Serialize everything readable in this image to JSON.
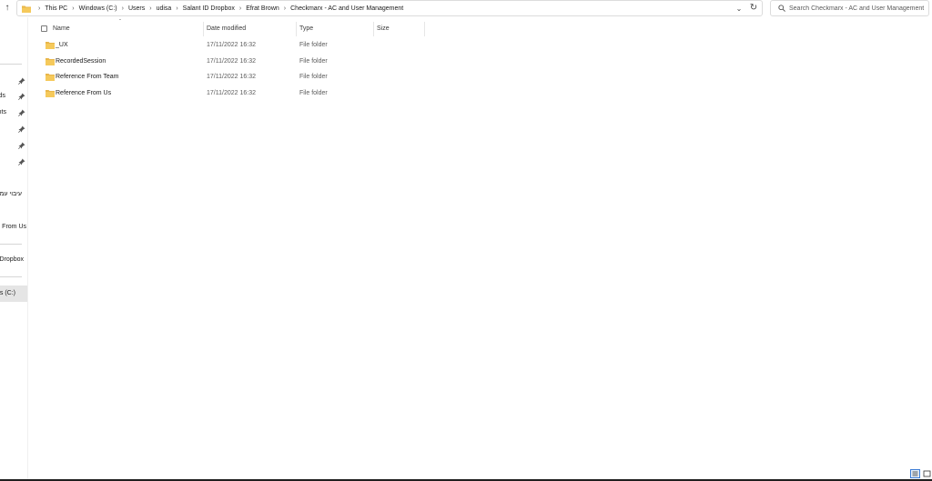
{
  "address_bar": {
    "breadcrumbs": [
      "This PC",
      "Windows (C:)",
      "Users",
      "udisa",
      "Salant ID Dropbox",
      "Efrat Brown",
      "Checkmarx - AC and User Management"
    ]
  },
  "search": {
    "placeholder": "Search Checkmarx - AC and User Management"
  },
  "nav": {
    "items": [
      {
        "label": "ds"
      },
      {
        "label": "nts"
      },
      {
        "label": "עיבוי עמ"
      },
      {
        "label": "e From Us"
      },
      {
        "label": "Dropbox"
      },
      {
        "label": "s (C:)"
      }
    ]
  },
  "columns": {
    "name": "Name",
    "date": "Date modified",
    "type": "Type",
    "size": "Size"
  },
  "files": [
    {
      "name": "_UX",
      "date": "17/11/2022 16:32",
      "type": "File folder"
    },
    {
      "name": "RecordedSession",
      "date": "17/11/2022 16:32",
      "type": "File folder"
    },
    {
      "name": "Reference From Team",
      "date": "17/11/2022 16:32",
      "type": "File folder"
    },
    {
      "name": "Reference From Us",
      "date": "17/11/2022 16:32",
      "type": "File folder"
    }
  ],
  "icons": {
    "folder": "folder-icon",
    "pin": "pin-icon",
    "up": "arrow-up-icon",
    "refresh": "refresh-icon",
    "search": "search-icon"
  },
  "colors": {
    "folder": "#e8b64a",
    "accent": "#3a7bd5"
  }
}
